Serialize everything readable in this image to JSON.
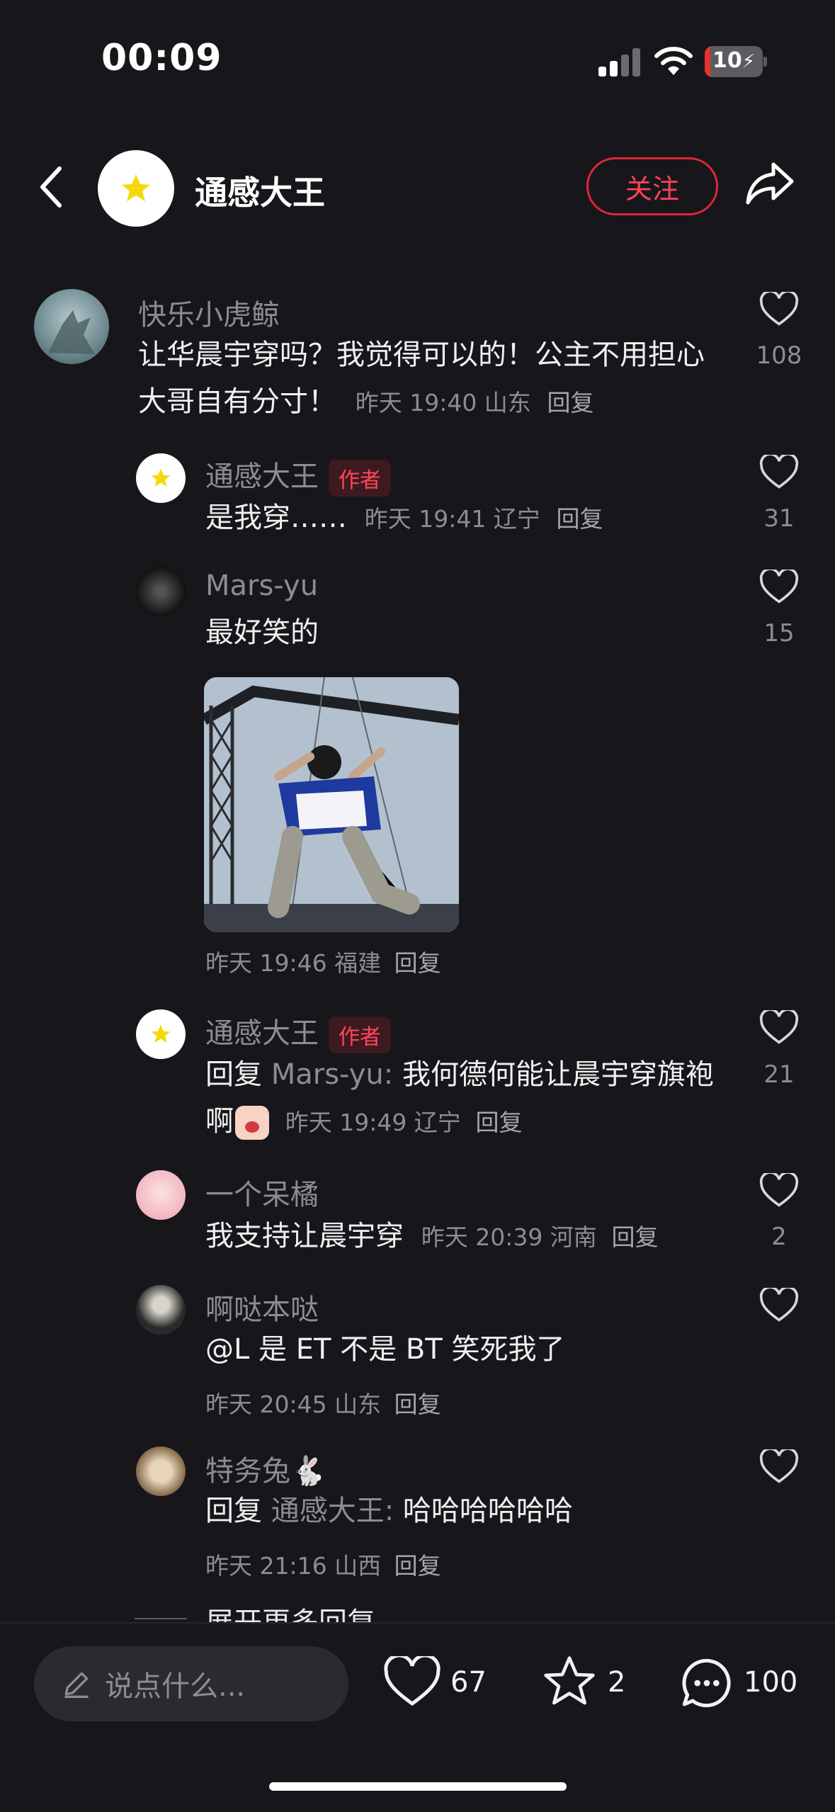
{
  "status_bar": {
    "time": "00:09",
    "battery": "10",
    "battery_level": 0.1
  },
  "header": {
    "name": "通感大王",
    "follow_label": "关注"
  },
  "comments": [
    {
      "user": "快乐小虎鲸",
      "text": "让华晨宇穿吗？我觉得可以的！公主不用担心大哥自有分寸！",
      "time": "昨天 19:40 山东",
      "reply": "回复",
      "likes": "108"
    },
    {
      "user": "通感大王",
      "badge": "作者",
      "text": "是我穿……",
      "time": "昨天 19:41 辽宁",
      "reply": "回复",
      "likes": "31"
    },
    {
      "user": "Mars-yu",
      "text": "最好笑的",
      "time": "昨天 19:46 福建",
      "reply": "回复",
      "likes": "15"
    },
    {
      "user": "通感大王",
      "badge": "作者",
      "prefix": "回复",
      "target": "Mars-yu:",
      "text": "我何德何能让晨宇穿旗袍啊",
      "time": "昨天 19:49 辽宁",
      "reply": "回复",
      "likes": "21"
    },
    {
      "user": "一个呆橘",
      "text": "我支持让晨宇穿",
      "time": "昨天 20:39 河南",
      "reply": "回复",
      "likes": "2"
    },
    {
      "user": "啊哒本哒",
      "text": "@L 是 ET 不是 BT 笑死我了",
      "time": "昨天 20:45 山东",
      "reply": "回复",
      "likes": ""
    },
    {
      "user": "特务兔🐇",
      "prefix": "回复",
      "target": "通感大王:",
      "text": "哈哈哈哈哈哈",
      "time": "昨天 21:16 山西",
      "reply": "回复",
      "likes": ""
    }
  ],
  "expand_more": "展开更多回复",
  "bottom_bar": {
    "input_placeholder": "说点什么...",
    "likes": "67",
    "favorites": "2",
    "comments": "100"
  },
  "colors": {
    "background": "#16161b",
    "accent": "#e02638",
    "star": "#f5d90a"
  }
}
